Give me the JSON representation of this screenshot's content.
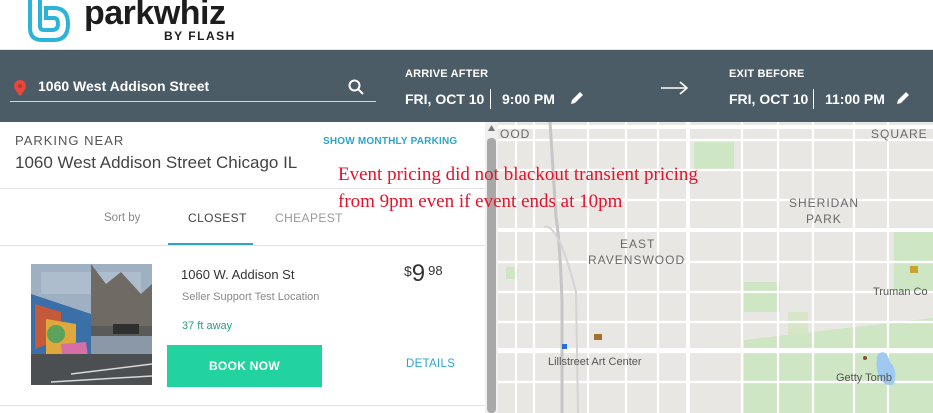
{
  "brand": {
    "name": "parkwhiz",
    "sub": "BY FLASH"
  },
  "search": {
    "location": "1060 West Addison Street",
    "arrive_label": "ARRIVE AFTER",
    "arrive_date": "FRI, OCT 10",
    "arrive_time": "9:00 PM",
    "exit_label": "EXIT BEFORE",
    "exit_date": "FRI, OCT 10",
    "exit_time": "11:00 PM"
  },
  "panel": {
    "title": "PARKING NEAR",
    "address": "1060 West Addison Street Chicago IL",
    "monthly_link": "SHOW MONTHLY PARKING",
    "sort_label": "Sort by",
    "tabs": [
      {
        "label": "CLOSEST",
        "active": true
      },
      {
        "label": "CHEAPEST",
        "active": false
      }
    ],
    "listing": {
      "name": "1060 W. Addison St",
      "subtitle": "Seller Support Test Location",
      "distance": "37 ft away",
      "price_currency": "$",
      "price_dollars": "9",
      "price_cents": "98",
      "book_label": "BOOK NOW",
      "details_label": "DETAILS"
    }
  },
  "map": {
    "labels": {
      "ood": "OOD",
      "square": "SQUARE",
      "sheridan": "SHERIDAN",
      "park": "PARK",
      "east": "EAST",
      "ravenswood": "RAVENSWOOD",
      "truman": "Truman Co",
      "lillstreet": "Lillstreet Art Center",
      "getty": "Getty Tomb"
    }
  },
  "annotation": {
    "line1": "Event pricing did not blackout transient pricing",
    "line2": "from 9pm even if event ends at 10pm"
  },
  "colors": {
    "header_bg": "#4b5c67",
    "accent_teal": "#2fa4c8",
    "book_green": "#22d3a0",
    "annotation_red": "#e8102a"
  },
  "icons": [
    "logo-mark-icon",
    "location-pin-icon",
    "search-icon",
    "pencil-icon",
    "arrow-right-icon"
  ]
}
